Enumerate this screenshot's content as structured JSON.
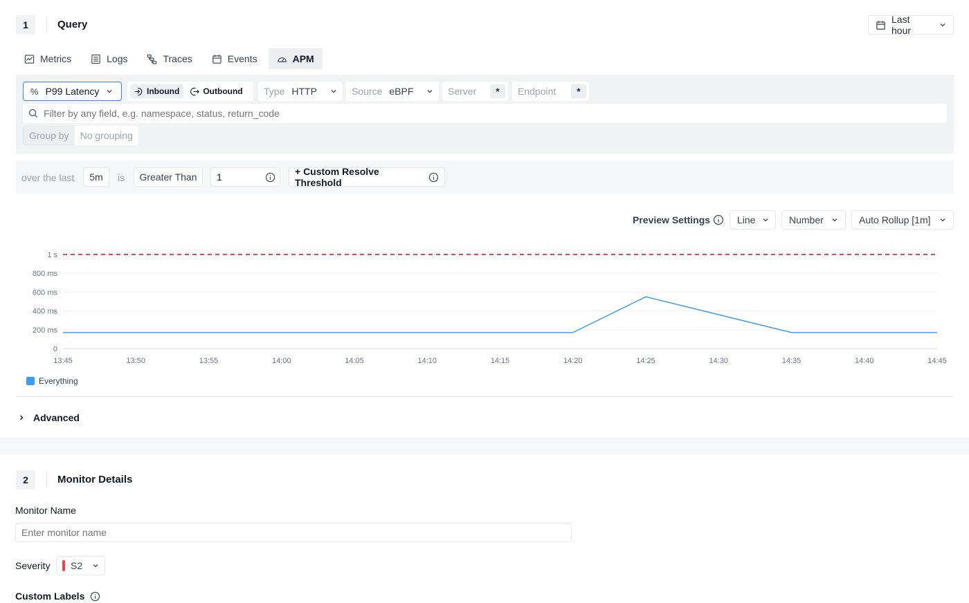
{
  "query_step": {
    "number": "1",
    "title": "Query"
  },
  "time_range": {
    "label": "Last hour"
  },
  "tabs": [
    {
      "label": "Metrics",
      "icon": "chart-line-icon"
    },
    {
      "label": "Logs",
      "icon": "list-icon"
    },
    {
      "label": "Traces",
      "icon": "trace-icon"
    },
    {
      "label": "Events",
      "icon": "calendar-icon"
    },
    {
      "label": "APM",
      "icon": "gauge-icon",
      "active": true
    }
  ],
  "filters": {
    "metric": "P99 Latency",
    "direction_inbound": "Inbound",
    "direction_outbound": "Outbound",
    "type_label": "Type",
    "type_value": "HTTP",
    "source_label": "Source",
    "source_value": "eBPF",
    "server_label": "Server",
    "server_value": "*",
    "endpoint_label": "Endpoint",
    "endpoint_value": "*",
    "search_placeholder": "Filter by any field, e.g. namespace, status, return_code",
    "group_by_label": "Group by",
    "group_by_value": "No grouping"
  },
  "condition": {
    "over_label": "over the last",
    "window": "5m",
    "is_label": "is",
    "operator": "Greater Than",
    "threshold": "1",
    "custom_resolve": "+ Custom Resolve Threshold"
  },
  "preview": {
    "label": "Preview Settings",
    "chart_type": "Line",
    "format": "Number",
    "rollup": "Auto Rollup [1m]"
  },
  "chart_data": {
    "type": "line",
    "x": [
      "13:45",
      "13:50",
      "13:55",
      "14:00",
      "14:05",
      "14:10",
      "14:15",
      "14:20",
      "14:25",
      "14:30",
      "14:35",
      "14:40",
      "14:45"
    ],
    "y_ticks": [
      "0",
      "200 ms",
      "400 ms",
      "600 ms",
      "800 ms",
      "1 s"
    ],
    "ylim": [
      0,
      1000
    ],
    "threshold": 1000,
    "threshold_color": "#ef4444",
    "series": [
      {
        "name": "Everything",
        "color": "#3b9cf5",
        "points": [
          [
            "13:45",
            170
          ],
          [
            "14:20",
            170
          ],
          [
            "14:25",
            550
          ],
          [
            "14:35",
            170
          ],
          [
            "14:45",
            170
          ]
        ]
      }
    ]
  },
  "advanced": {
    "label": "Advanced"
  },
  "details_step": {
    "number": "2",
    "title": "Monitor Details"
  },
  "monitor_name": {
    "label": "Monitor Name",
    "placeholder": "Enter monitor name"
  },
  "severity": {
    "label": "Severity",
    "value": "S2",
    "color": "#ef4444"
  },
  "custom_labels": {
    "label": "Custom Labels"
  }
}
